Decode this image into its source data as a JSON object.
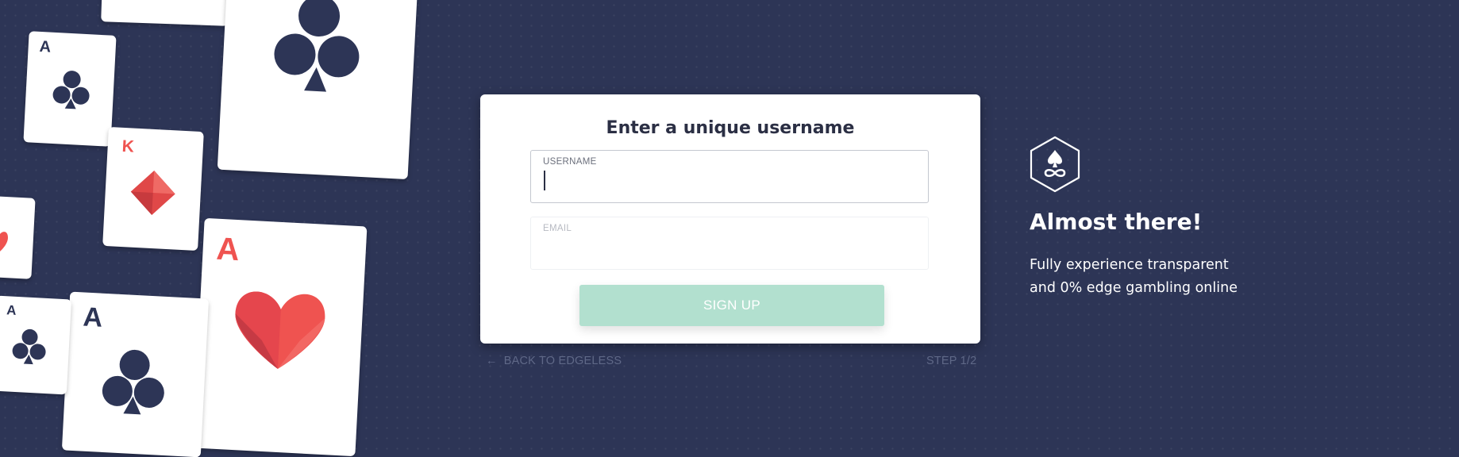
{
  "form": {
    "title": "Enter a unique username",
    "username": {
      "label": "USERNAME",
      "value": ""
    },
    "email": {
      "label": "EMAIL",
      "value": ""
    },
    "submit_label": "SIGN UP"
  },
  "footer": {
    "back_label": "BACK TO EDGELESS",
    "back_icon": "arrow-left-icon",
    "step": "STEP 1/2"
  },
  "promo": {
    "logo_icon": "edgeless-logo-icon",
    "headline": "Almost there!",
    "line1": "Fully experience transparent",
    "line2": "and 0% edge gambling online"
  },
  "cards": [
    {
      "rank": "A",
      "suit": "club"
    },
    {
      "rank": "K",
      "suit": "diamond"
    },
    {
      "rank": "A",
      "suit": "heart"
    },
    {
      "rank": "A",
      "suit": "club"
    },
    {
      "rank": "A",
      "suit": "club"
    }
  ],
  "colors": {
    "background": "#2d3556",
    "navy": "#2d3556",
    "red": "#ef5350",
    "button": "#b2e0cf"
  }
}
